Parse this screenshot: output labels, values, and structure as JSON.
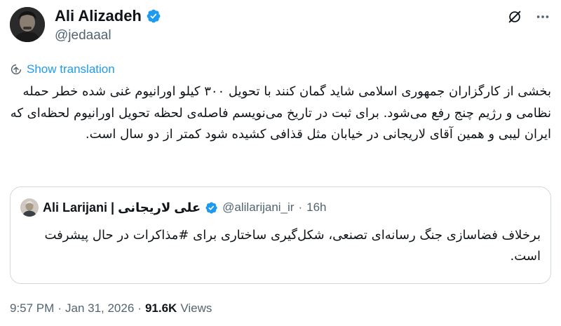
{
  "author": {
    "display_name": "Ali Alizadeh",
    "handle": "@jedaaal",
    "verified": true
  },
  "header_actions": {
    "grok_icon": "grok-icon",
    "more_icon": "more-horizontal-icon"
  },
  "translation": {
    "icon": "translate-icon",
    "label": "Show translation"
  },
  "tweet": {
    "text": "بخشی از کارگزاران جمهوری اسلامی شاید گمان کنند با تحویل ۳۰۰ کیلو اورانیوم غنی شده خطر حمله نظامی و رژیم چنج رفع می‌شود. برای ثبت در تاریخ می‌نویسم فاصله‌ی لحظه تحویل اورانیوم لحظه‌ای که ایران لیبی و همین آقای لاریجانی در خیابان مثل قذافی کشیده شود کمتر از دو سال است."
  },
  "quote": {
    "display_name": "Ali Larijani | علی لاریجانی",
    "verified": true,
    "handle": "@alilarijani_ir",
    "separator": "·",
    "time": "16h",
    "text": "برخلاف فضاسازی جنگ رسانه‌ای تصنعی، شکل‌گیری ساختاری برای #مذاکرات در حال پیشرفت است."
  },
  "meta": {
    "time": "9:57 PM",
    "sep1": "·",
    "date": "Jan 31, 2026",
    "sep2": "·",
    "views_count": "91.6K",
    "views_label": "Views"
  },
  "colors": {
    "accent": "#1d9bf0",
    "text_primary": "#0f1419",
    "text_secondary": "#536471",
    "border": "#cfd9de"
  }
}
